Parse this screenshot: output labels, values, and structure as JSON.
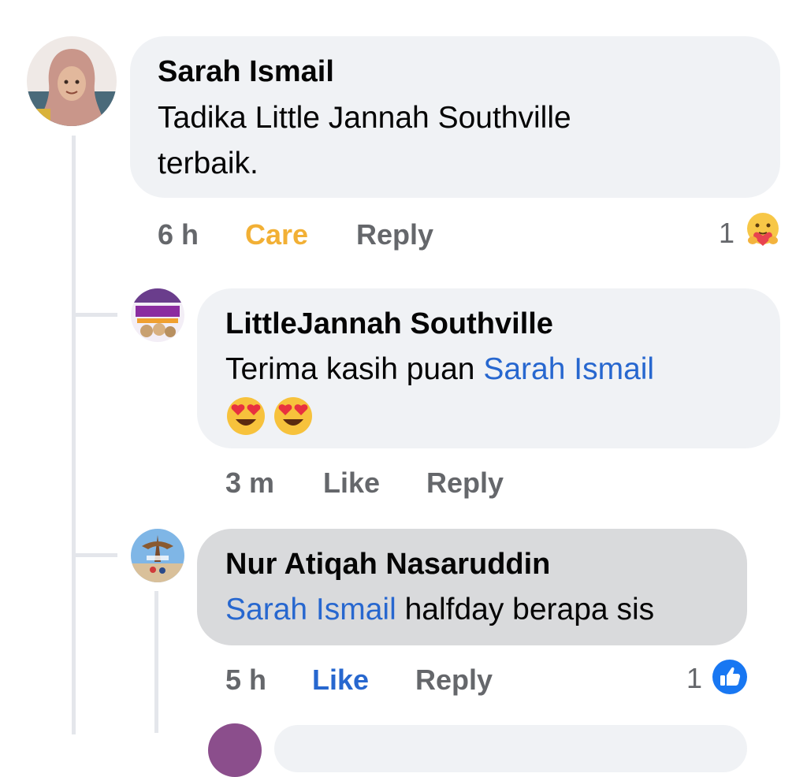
{
  "comments": [
    {
      "author": "Sarah Ismail",
      "text": "Tadika Little Jannah Southville terbaik.",
      "time": "6 h",
      "reaction_label": "Care",
      "reply_label": "Reply",
      "reaction_count": "1",
      "reaction_icon": "care-emoji-icon"
    },
    {
      "author": "LittleJannah Southville",
      "text_prefix": "Terima kasih puan ",
      "mention": "Sarah Ismail",
      "emojis": [
        "heart-eyes-emoji-icon",
        "heart-eyes-emoji-icon"
      ],
      "time": "3 m",
      "like_label": "Like",
      "reply_label": "Reply"
    },
    {
      "author": "Nur Atiqah Nasaruddin",
      "mention": "Sarah Ismail",
      "text_suffix": " halfday berapa sis",
      "time": "5 h",
      "like_label": "Like",
      "reply_label": "Reply",
      "reaction_count": "1",
      "reaction_icon": "like-badge-icon"
    }
  ],
  "colors": {
    "bubble": "#f0f2f5",
    "bubble_highlight": "#d9dadc",
    "mention": "#2767cf",
    "care": "#f2b035",
    "like_active": "#2767cf",
    "meta": "#65676b"
  }
}
